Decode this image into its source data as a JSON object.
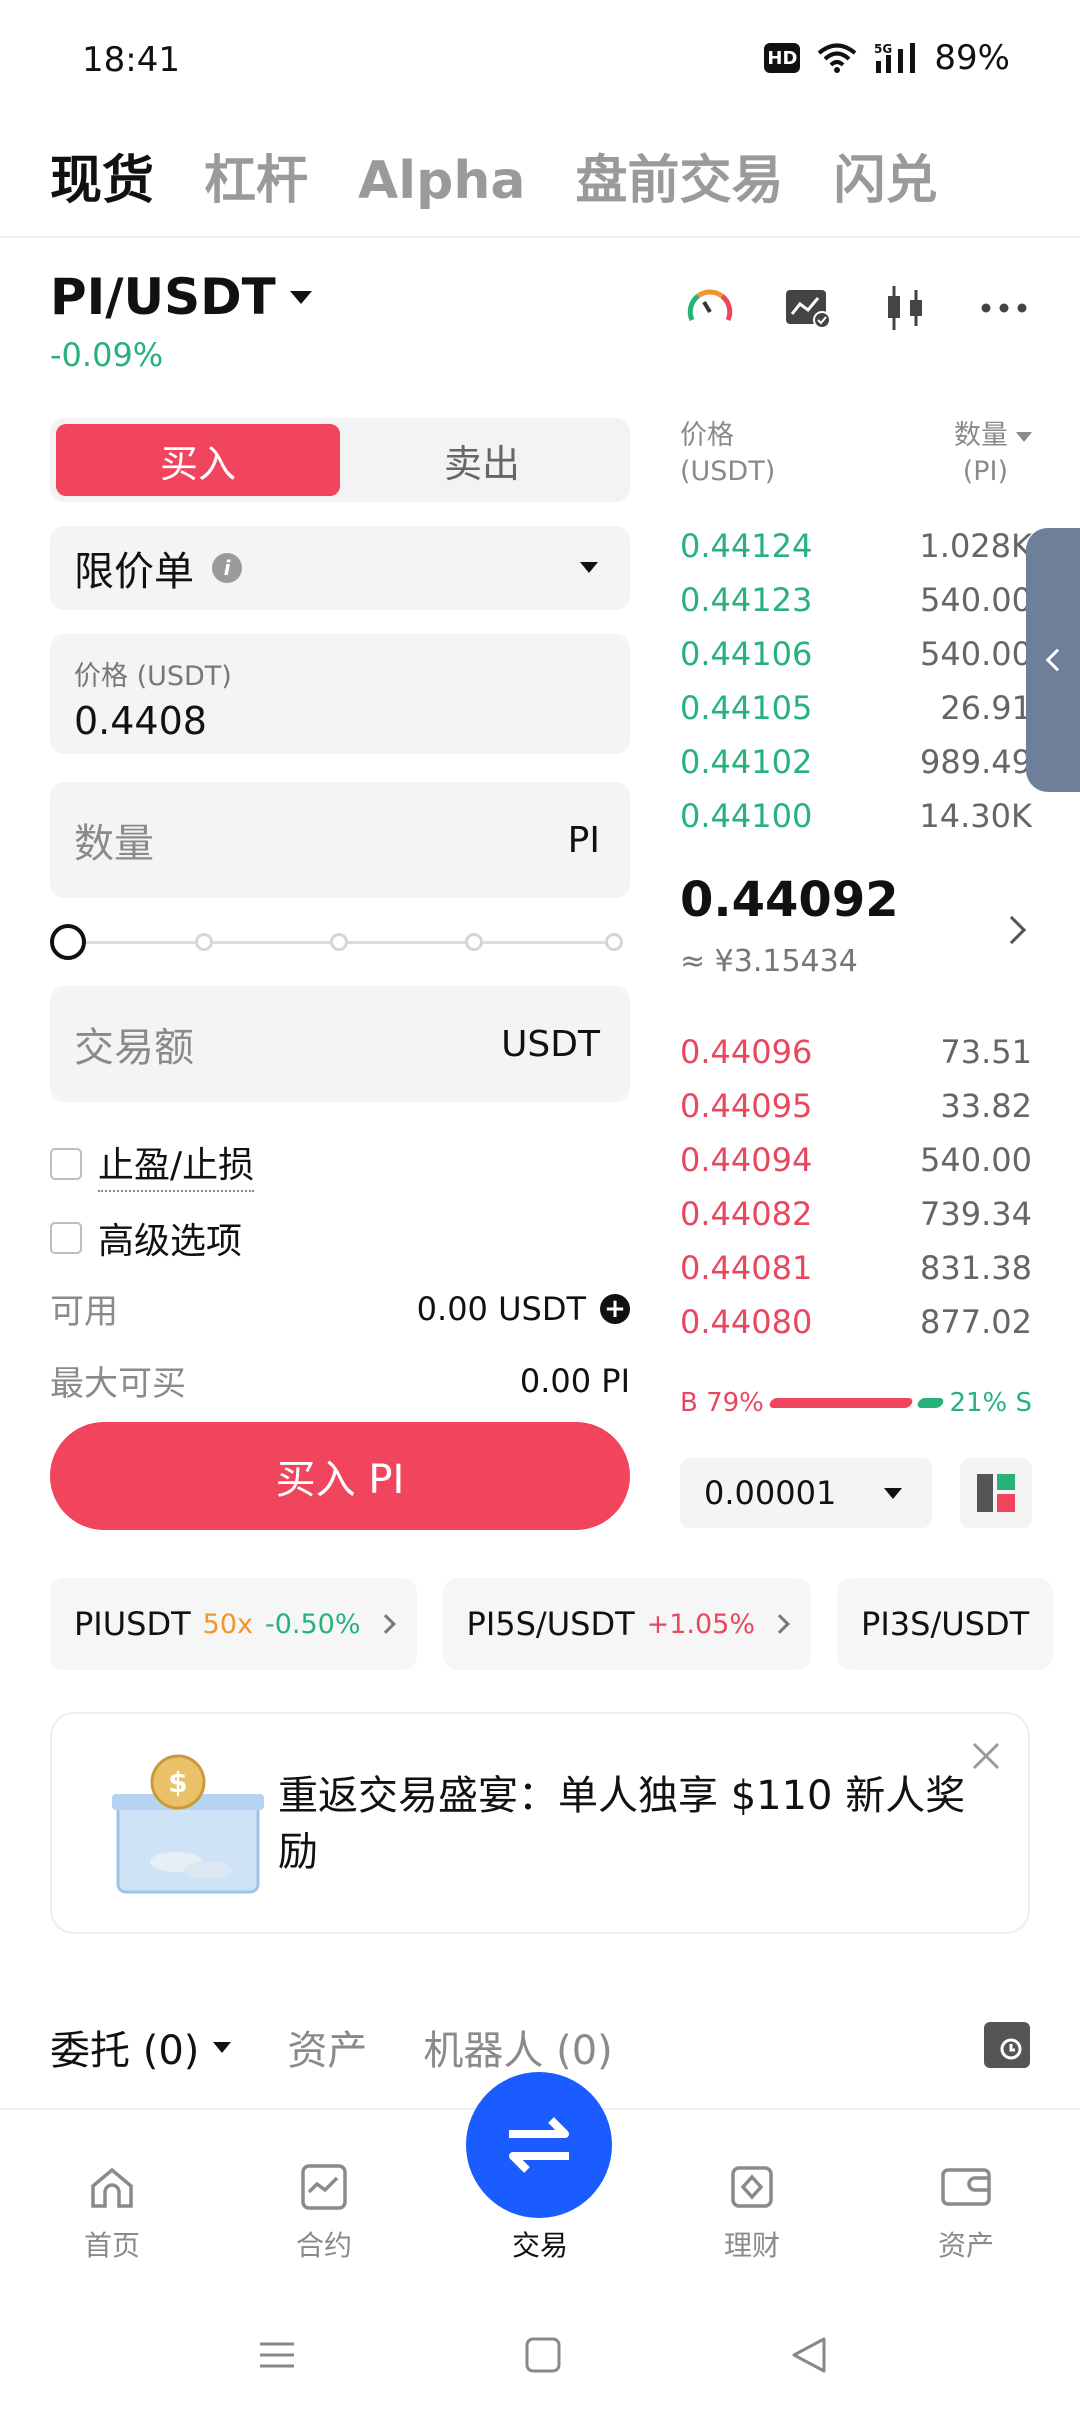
{
  "status_bar": {
    "time": "18:41",
    "hd": "HD",
    "network": "5G",
    "battery": "89%"
  },
  "top_tabs": [
    {
      "label": "现货",
      "active": true
    },
    {
      "label": "杠杆",
      "active": false
    },
    {
      "label": "Alpha",
      "active": false
    },
    {
      "label": "盘前交易",
      "active": false
    },
    {
      "label": "闪兑",
      "active": false
    }
  ],
  "pair": {
    "name": "PI/USDT",
    "change": "-0.09%"
  },
  "header_icons": [
    "gauge-icon",
    "chart-alert-icon",
    "candlestick-icon",
    "more-icon"
  ],
  "trade_form": {
    "buy_label": "买入",
    "sell_label": "卖出",
    "order_type": "限价单",
    "price_label": "价格 (USDT)",
    "price_value": "0.4408",
    "qty_placeholder": "数量",
    "qty_unit": "PI",
    "amount_placeholder": "交易额",
    "amount_unit": "USDT",
    "slider_percent": 0,
    "tp_sl_label": "止盈/止损",
    "advanced_label": "高级选项",
    "available_label": "可用",
    "available_value": "0.00 USDT",
    "max_buy_label": "最大可买",
    "max_buy_value": "0.00 PI",
    "submit_label": "买入 PI"
  },
  "order_book": {
    "price_header_1": "价格",
    "price_header_2": "(USDT)",
    "qty_header_1": "数量",
    "qty_header_2": "(PI)",
    "asks": [
      {
        "price": "0.44124",
        "qty": "1.028K"
      },
      {
        "price": "0.44123",
        "qty": "540.00"
      },
      {
        "price": "0.44106",
        "qty": "540.00"
      },
      {
        "price": "0.44105",
        "qty": "26.91"
      },
      {
        "price": "0.44102",
        "qty": "989.49"
      },
      {
        "price": "0.44100",
        "qty": "14.30K"
      }
    ],
    "last_price": "0.44092",
    "last_price_fiat": "≈ ¥3.15434",
    "bids": [
      {
        "price": "0.44096",
        "qty": "73.51"
      },
      {
        "price": "0.44095",
        "qty": "33.82"
      },
      {
        "price": "0.44094",
        "qty": "540.00"
      },
      {
        "price": "0.44082",
        "qty": "739.34"
      },
      {
        "price": "0.44081",
        "qty": "831.38"
      },
      {
        "price": "0.44080",
        "qty": "877.02"
      }
    ],
    "buy_ratio": "B 79%",
    "sell_ratio": "21% S",
    "precision": "0.00001"
  },
  "related_pairs": [
    {
      "name": "PIUSDT",
      "leverage": "50x",
      "change": "-0.50%",
      "dir": "down"
    },
    {
      "name": "PI5S/USDT",
      "leverage": "",
      "change": "+1.05%",
      "dir": "up"
    },
    {
      "name": "PI3S/USDT",
      "leverage": "",
      "change": "",
      "dir": ""
    }
  ],
  "promo": {
    "text": "重返交易盛宴：单人独享 $110 新人奖励"
  },
  "orders_tabs": [
    {
      "label": "委托 (0)",
      "active": true
    },
    {
      "label": "资产",
      "active": false
    },
    {
      "label": "机器人 (0)",
      "active": false
    }
  ],
  "bottom_nav": [
    {
      "label": "首页",
      "icon": "home-icon"
    },
    {
      "label": "合约",
      "icon": "futures-icon"
    },
    {
      "label": "交易",
      "icon": "swap-icon",
      "active": true
    },
    {
      "label": "理财",
      "icon": "earn-icon"
    },
    {
      "label": "资产",
      "icon": "wallet-icon"
    }
  ],
  "colors": {
    "buy": "#f0455c",
    "sell": "#27b27c",
    "primary": "#1a5cff"
  }
}
